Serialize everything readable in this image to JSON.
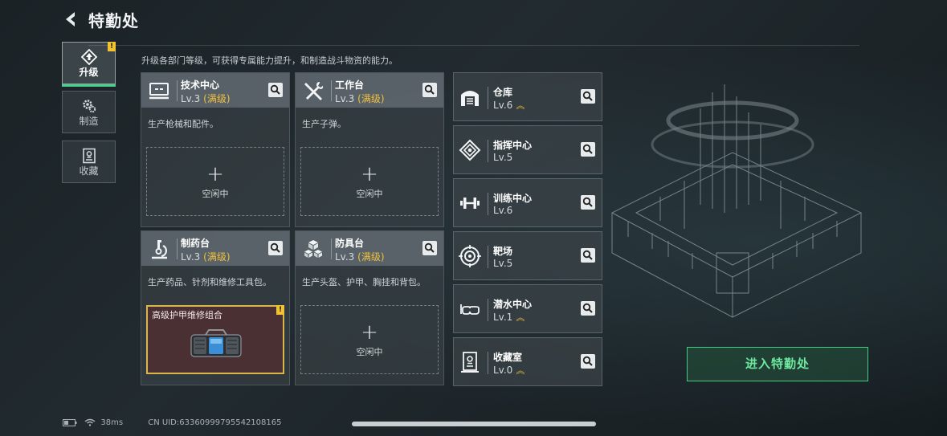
{
  "header": {
    "title": "特勤处"
  },
  "description": "升级各部门等级，可获得专属能力提升，和制造战斗物资的能力。",
  "sidebar": [
    {
      "label": "升级",
      "icon": "upgrade-icon",
      "active": true,
      "badge": "!"
    },
    {
      "label": "制造",
      "icon": "craft-gears-icon",
      "active": false
    },
    {
      "label": "收藏",
      "icon": "collection-icon",
      "active": false
    }
  ],
  "departments": [
    {
      "name": "技术中心",
      "level": "Lv.3",
      "max_label": "(满级)",
      "desc": "生产枪械和配件。",
      "slot": {
        "plus": "+",
        "state": "空闲中"
      },
      "icon": "tech-center-icon"
    },
    {
      "name": "工作台",
      "level": "Lv.3",
      "max_label": "(满级)",
      "desc": "生产子弹。",
      "slot": {
        "plus": "+",
        "state": "空闲中"
      },
      "icon": "workbench-tools-icon"
    },
    {
      "name": "制药台",
      "level": "Lv.3",
      "max_label": "(满级)",
      "desc": "生产药品、针剂和维修工具包。",
      "crafting": {
        "item": "高级护甲维修组合",
        "badge": "!"
      },
      "icon": "pharmacy-microscope-icon"
    },
    {
      "name": "防具台",
      "level": "Lv.3",
      "max_label": "(满级)",
      "desc": "生产头盔、护甲、胸挂和背包。",
      "slot": {
        "plus": "+",
        "state": "空闲中"
      },
      "icon": "armor-cubes-icon"
    }
  ],
  "facilities": [
    {
      "name": "仓库",
      "level": "Lv.6",
      "upgradeable": true,
      "icon": "warehouse-icon"
    },
    {
      "name": "指挥中心",
      "level": "Lv.5",
      "upgradeable": false,
      "icon": "command-center-icon"
    },
    {
      "name": "训练中心",
      "level": "Lv.6",
      "upgradeable": false,
      "icon": "dumbbell-icon"
    },
    {
      "name": "靶场",
      "level": "Lv.5",
      "upgradeable": false,
      "icon": "target-icon"
    },
    {
      "name": "潜水中心",
      "level": "Lv.1",
      "upgradeable": true,
      "icon": "diving-goggles-icon"
    },
    {
      "name": "收藏室",
      "level": "Lv.0",
      "upgradeable": true,
      "icon": "collection-room-icon"
    }
  ],
  "upgrade_glyph": "︽",
  "enter_button": "进入特勤处",
  "status": {
    "ping": "38ms",
    "uid": "CN UID:633609997955421081​65"
  },
  "colors": {
    "accent_green": "#46d08a",
    "max_gold": "#f0c040"
  }
}
